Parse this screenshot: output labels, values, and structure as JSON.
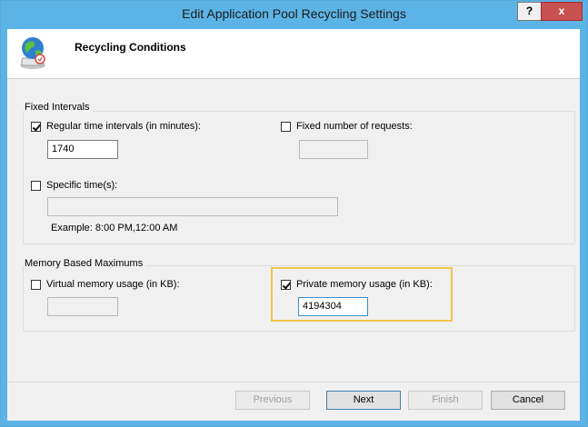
{
  "window": {
    "title": "Edit Application Pool Recycling Settings",
    "help_label": "?",
    "close_label": "x"
  },
  "header": {
    "title": "Recycling Conditions",
    "icon": "globe-recycle-icon"
  },
  "fixed_intervals": {
    "label": "Fixed Intervals",
    "regular": {
      "label": "Regular time intervals (in minutes):",
      "checked": true,
      "value": "1740"
    },
    "requests": {
      "label": "Fixed number of requests:",
      "checked": false,
      "value": ""
    },
    "specific": {
      "label": "Specific time(s):",
      "checked": false,
      "value": "",
      "example": "Example: 8:00 PM,12:00 AM"
    }
  },
  "memory": {
    "label": "Memory Based Maximums",
    "virtual": {
      "label": "Virtual memory usage (in KB):",
      "checked": false,
      "value": ""
    },
    "private": {
      "label": "Private memory usage (in KB):",
      "checked": true,
      "value": "4194304"
    }
  },
  "buttons": {
    "previous": "Previous",
    "next": "Next",
    "finish": "Finish",
    "cancel": "Cancel"
  },
  "colors": {
    "titlebar": "#5cb4e6",
    "highlight": "#f3c44a",
    "close": "#c75050"
  }
}
